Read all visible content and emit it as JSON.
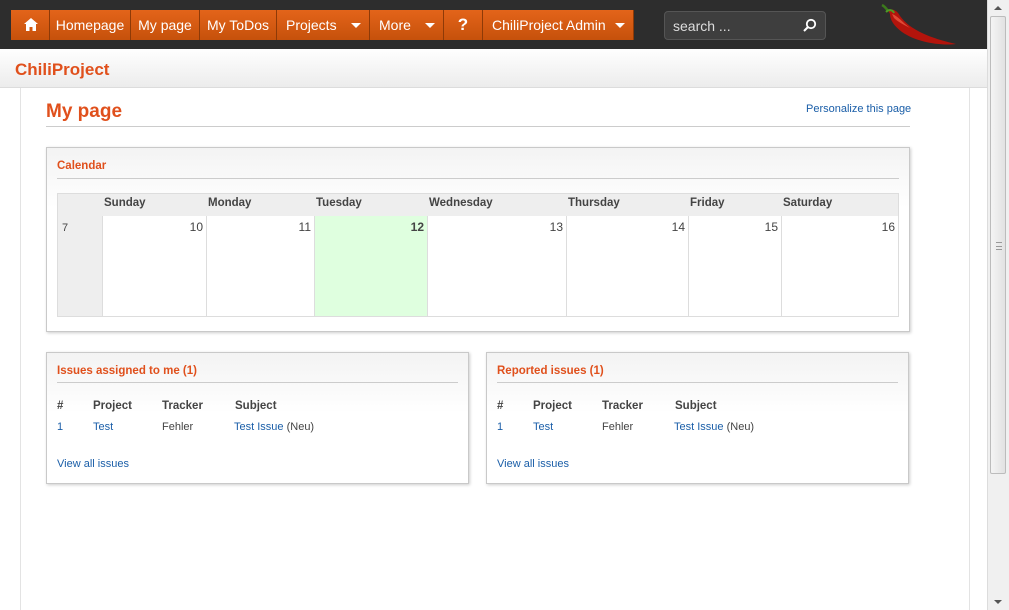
{
  "nav": {
    "home_icon": "home-icon",
    "homepage": "Homepage",
    "mypage": "My page",
    "mytodos": "My ToDos",
    "projects": "Projects",
    "more": "More",
    "help": "?",
    "admin": "ChiliProject Admin"
  },
  "search": {
    "placeholder": "search ..."
  },
  "header": {
    "title": "ChiliProject"
  },
  "page": {
    "title": "My page",
    "personalize": "Personalize this page"
  },
  "calendar": {
    "title": "Calendar",
    "days": [
      "Sunday",
      "Monday",
      "Tuesday",
      "Wednesday",
      "Thursday",
      "Friday",
      "Saturday"
    ],
    "week": "7",
    "dates": [
      "10",
      "11",
      "12",
      "13",
      "14",
      "15",
      "16"
    ],
    "today_index": 2
  },
  "assigned": {
    "title": "Issues assigned to me (1)",
    "headers": [
      "#",
      "Project",
      "Tracker",
      "Subject"
    ],
    "rows": [
      {
        "id": "1",
        "project": "Test",
        "tracker": "Fehler",
        "subject": "Test Issue",
        "status": "(Neu)"
      }
    ],
    "view_all": "View all issues"
  },
  "reported": {
    "title": "Reported issues (1)",
    "headers": [
      "#",
      "Project",
      "Tracker",
      "Subject"
    ],
    "rows": [
      {
        "id": "1",
        "project": "Test",
        "tracker": "Fehler",
        "subject": "Test Issue",
        "status": "(Neu)"
      }
    ],
    "view_all": "View all issues"
  },
  "colors": {
    "accent": "#e0501c",
    "nav": "#d55a12",
    "link": "#1a5ea8",
    "today": "#dfffdf"
  }
}
